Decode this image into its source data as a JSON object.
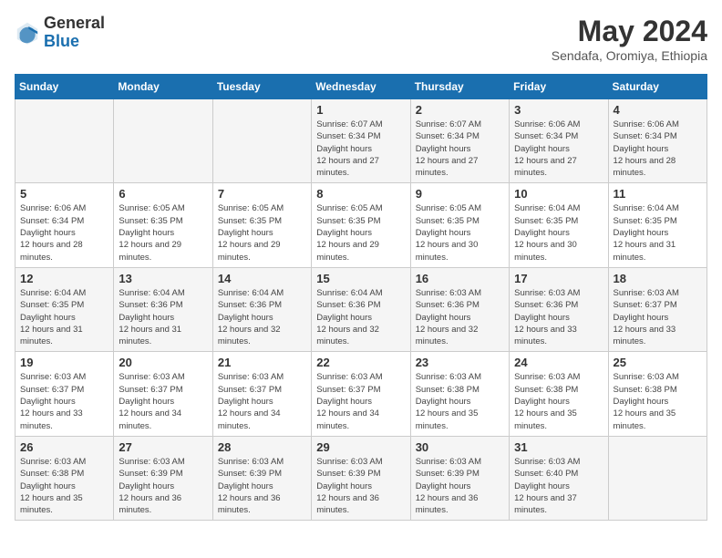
{
  "header": {
    "logo_general": "General",
    "logo_blue": "Blue",
    "month_year": "May 2024",
    "location": "Sendafa, Oromiya, Ethiopia"
  },
  "weekdays": [
    "Sunday",
    "Monday",
    "Tuesday",
    "Wednesday",
    "Thursday",
    "Friday",
    "Saturday"
  ],
  "weeks": [
    [
      null,
      null,
      null,
      {
        "day": 1,
        "sunrise": "6:07 AM",
        "sunset": "6:34 PM",
        "daylight": "12 hours and 27 minutes."
      },
      {
        "day": 2,
        "sunrise": "6:07 AM",
        "sunset": "6:34 PM",
        "daylight": "12 hours and 27 minutes."
      },
      {
        "day": 3,
        "sunrise": "6:06 AM",
        "sunset": "6:34 PM",
        "daylight": "12 hours and 27 minutes."
      },
      {
        "day": 4,
        "sunrise": "6:06 AM",
        "sunset": "6:34 PM",
        "daylight": "12 hours and 28 minutes."
      }
    ],
    [
      {
        "day": 5,
        "sunrise": "6:06 AM",
        "sunset": "6:34 PM",
        "daylight": "12 hours and 28 minutes."
      },
      {
        "day": 6,
        "sunrise": "6:05 AM",
        "sunset": "6:35 PM",
        "daylight": "12 hours and 29 minutes."
      },
      {
        "day": 7,
        "sunrise": "6:05 AM",
        "sunset": "6:35 PM",
        "daylight": "12 hours and 29 minutes."
      },
      {
        "day": 8,
        "sunrise": "6:05 AM",
        "sunset": "6:35 PM",
        "daylight": "12 hours and 29 minutes."
      },
      {
        "day": 9,
        "sunrise": "6:05 AM",
        "sunset": "6:35 PM",
        "daylight": "12 hours and 30 minutes."
      },
      {
        "day": 10,
        "sunrise": "6:04 AM",
        "sunset": "6:35 PM",
        "daylight": "12 hours and 30 minutes."
      },
      {
        "day": 11,
        "sunrise": "6:04 AM",
        "sunset": "6:35 PM",
        "daylight": "12 hours and 31 minutes."
      }
    ],
    [
      {
        "day": 12,
        "sunrise": "6:04 AM",
        "sunset": "6:35 PM",
        "daylight": "12 hours and 31 minutes."
      },
      {
        "day": 13,
        "sunrise": "6:04 AM",
        "sunset": "6:36 PM",
        "daylight": "12 hours and 31 minutes."
      },
      {
        "day": 14,
        "sunrise": "6:04 AM",
        "sunset": "6:36 PM",
        "daylight": "12 hours and 32 minutes."
      },
      {
        "day": 15,
        "sunrise": "6:04 AM",
        "sunset": "6:36 PM",
        "daylight": "12 hours and 32 minutes."
      },
      {
        "day": 16,
        "sunrise": "6:03 AM",
        "sunset": "6:36 PM",
        "daylight": "12 hours and 32 minutes."
      },
      {
        "day": 17,
        "sunrise": "6:03 AM",
        "sunset": "6:36 PM",
        "daylight": "12 hours and 33 minutes."
      },
      {
        "day": 18,
        "sunrise": "6:03 AM",
        "sunset": "6:37 PM",
        "daylight": "12 hours and 33 minutes."
      }
    ],
    [
      {
        "day": 19,
        "sunrise": "6:03 AM",
        "sunset": "6:37 PM",
        "daylight": "12 hours and 33 minutes."
      },
      {
        "day": 20,
        "sunrise": "6:03 AM",
        "sunset": "6:37 PM",
        "daylight": "12 hours and 34 minutes."
      },
      {
        "day": 21,
        "sunrise": "6:03 AM",
        "sunset": "6:37 PM",
        "daylight": "12 hours and 34 minutes."
      },
      {
        "day": 22,
        "sunrise": "6:03 AM",
        "sunset": "6:37 PM",
        "daylight": "12 hours and 34 minutes."
      },
      {
        "day": 23,
        "sunrise": "6:03 AM",
        "sunset": "6:38 PM",
        "daylight": "12 hours and 35 minutes."
      },
      {
        "day": 24,
        "sunrise": "6:03 AM",
        "sunset": "6:38 PM",
        "daylight": "12 hours and 35 minutes."
      },
      {
        "day": 25,
        "sunrise": "6:03 AM",
        "sunset": "6:38 PM",
        "daylight": "12 hours and 35 minutes."
      }
    ],
    [
      {
        "day": 26,
        "sunrise": "6:03 AM",
        "sunset": "6:38 PM",
        "daylight": "12 hours and 35 minutes."
      },
      {
        "day": 27,
        "sunrise": "6:03 AM",
        "sunset": "6:39 PM",
        "daylight": "12 hours and 36 minutes."
      },
      {
        "day": 28,
        "sunrise": "6:03 AM",
        "sunset": "6:39 PM",
        "daylight": "12 hours and 36 minutes."
      },
      {
        "day": 29,
        "sunrise": "6:03 AM",
        "sunset": "6:39 PM",
        "daylight": "12 hours and 36 minutes."
      },
      {
        "day": 30,
        "sunrise": "6:03 AM",
        "sunset": "6:39 PM",
        "daylight": "12 hours and 36 minutes."
      },
      {
        "day": 31,
        "sunrise": "6:03 AM",
        "sunset": "6:40 PM",
        "daylight": "12 hours and 37 minutes."
      },
      null
    ]
  ],
  "row_styles": [
    "light",
    "white",
    "light",
    "white",
    "light"
  ]
}
